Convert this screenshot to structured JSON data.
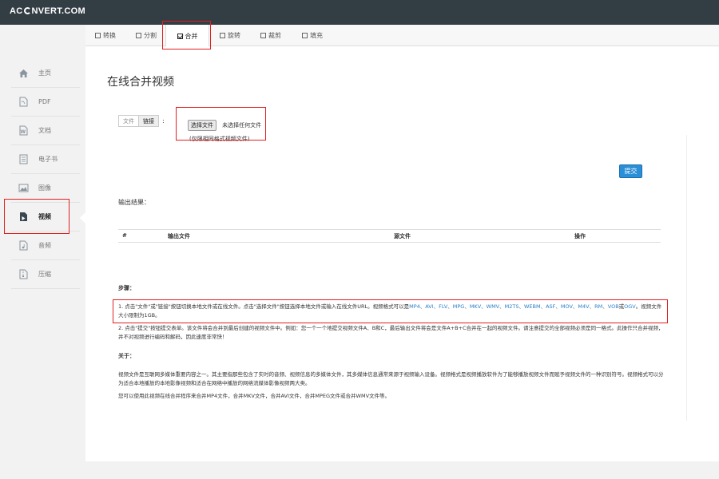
{
  "app": {
    "logo_left": "AC",
    "logo_right": "NVERT.COM"
  },
  "sidebar": {
    "items": [
      {
        "label": "主页",
        "icon": "home-icon"
      },
      {
        "label": "PDF",
        "icon": "pdf-icon"
      },
      {
        "label": "文档",
        "icon": "word-doc-icon"
      },
      {
        "label": "电子书",
        "icon": "ebook-icon"
      },
      {
        "label": "图像",
        "icon": "image-icon"
      },
      {
        "label": "视频",
        "icon": "video-icon",
        "active": true
      },
      {
        "label": "音频",
        "icon": "audio-icon"
      },
      {
        "label": "压缩",
        "icon": "archive-icon"
      }
    ]
  },
  "tabs": [
    {
      "label": "转换"
    },
    {
      "label": "分割"
    },
    {
      "label": "合并",
      "active": true
    },
    {
      "label": "旋转"
    },
    {
      "label": "裁剪"
    },
    {
      "label": "填充"
    }
  ],
  "main": {
    "title": "在线合并视频",
    "upload_mode": {
      "file_label": "文件",
      "link_label": "链接",
      "colon": ":"
    },
    "file_input": {
      "button_label": "选择文件",
      "status": "未选择任何文件",
      "hint": "(仅限相同格式视频文件)"
    },
    "submit_label": "提交",
    "output_label": "输出结果：",
    "table_headers": [
      "#",
      "输出文件",
      "源文件",
      "操作"
    ],
    "steps_label": "步骤：",
    "step1_text": "1. 点击\"文件\"或\"链接\"按钮切换本地文件或在线文件。点击\"选择文件\"按钮选择本地文件或输入在线文件URL。视频格式可以是",
    "step1_formats": "MP4、AVI、FLV、MPG、MKV、WMV、M2TS、WEBM、ASF、MOV、M4V、RM、VOB",
    "step1_or": "或",
    "step1_last_format": "OGV",
    "step1_tail": "。视频文件大小限制为1GB。",
    "step2_text": "2. 点击\"提交\"按钮提交表单。该文件将会合并到最后创建的视频文件中。例如：您一个一个地提交视频文件A、B和C，最后输出文件将会是文件A+B+C合并在一起的视频文件。请注意提交的全部视频必须是同一格式。此操作只合并视频，并不对视频进行编码和解码，因此速度非常快！",
    "about_label": "关于：",
    "about_p1": "视频文件是互联网多媒体重要内容之一。其主要指那些包含了实时的音频、视频信息的多媒体文件，其多媒体信息通常来源于视频输入设备。视频格式是视频播放软件为了能够播放视频文件而赋予视频文件的一种识别符号。视频格式可以分为适合本地播放的本地影像视频和适合在网络中播放的网络流媒体影像视频两大类。",
    "about_p2": "您可以使用此视频在线合并程序来合并MP4文件，合并MKV文件，合并AVI文件，合并MPEG文件或合并WMV文件等。"
  },
  "colors": {
    "topbar": "#333d44",
    "accent": "#2a8fd6",
    "link": "#2a7fc6",
    "highlight": "#e02020"
  }
}
